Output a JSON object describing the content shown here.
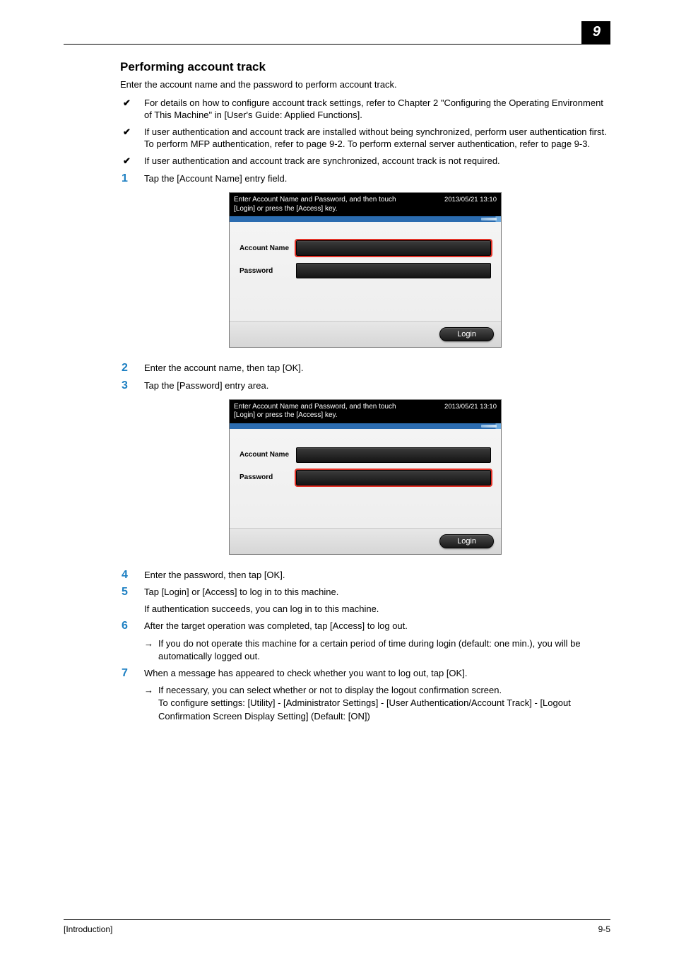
{
  "chapter_number": "9",
  "section_title": "Performing account track",
  "intro": "Enter the account name and the password to perform account track.",
  "bullets": [
    "For details on how to configure account track settings, refer to Chapter 2 \"Configuring the Operating Environment of This Machine\" in [User's Guide: Applied Functions].",
    "If user authentication and account track are installed without being synchronized, perform user authentication first. To perform MFP authentication, refer to page 9-2. To perform external server authentication, refer to page 9-3.",
    "If user authentication and account track are synchronized, account track is not required."
  ],
  "steps": {
    "s1": {
      "num": "1",
      "text": "Tap the [Account Name] entry field."
    },
    "s2": {
      "num": "2",
      "text": "Enter the account name, then tap [OK]."
    },
    "s3": {
      "num": "3",
      "text": "Tap the [Password] entry area."
    },
    "s4": {
      "num": "4",
      "text": "Enter the password, then tap [OK]."
    },
    "s5": {
      "num": "5",
      "text": "Tap [Login] or [Access] to log in to this machine.",
      "extra": "If authentication succeeds, you can log in to this machine."
    },
    "s6": {
      "num": "6",
      "text": "After the target operation was completed, tap [Access] to log out.",
      "sub": "If you do not operate this machine for a certain period of time during login (default: one min.), you will be automatically logged out."
    },
    "s7": {
      "num": "7",
      "text": "When a message has appeared to check whether you want to log out, tap [OK].",
      "sub": "If necessary, you can select whether or not to display the logout confirmation screen.\nTo configure settings: [Utility] - [Administrator Settings] - [User Authentication/Account Track] - [Logout Confirmation Screen Display Setting] (Default: [ON])"
    }
  },
  "mfp": {
    "instruction": "Enter Account Name and Password, and then touch [Login] or press the [Access] key.",
    "timestamp": "2013/05/21 13:10",
    "field_account": "Account Name",
    "field_password": "Password",
    "login_button": "Login"
  },
  "footer": {
    "left": "[Introduction]",
    "right": "9-5"
  }
}
